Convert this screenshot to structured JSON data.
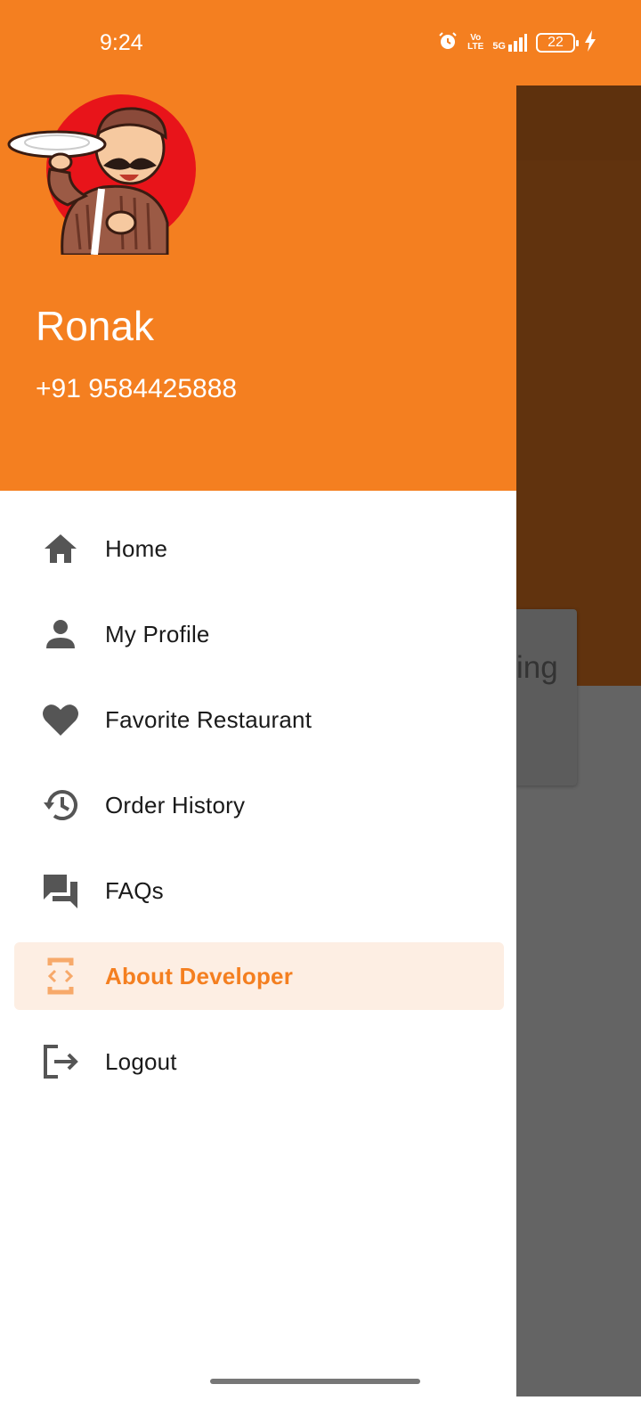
{
  "status_bar": {
    "time": "9:24",
    "icons": [
      "alarm-icon",
      "volte-icon",
      "5g-signal-icon",
      "battery-icon",
      "charging-icon"
    ],
    "network_top": "Vo",
    "network_bottom": "LTE",
    "network_type": "5G",
    "battery_level": "22"
  },
  "background_app": {
    "partial_text": "ing"
  },
  "drawer": {
    "header": {
      "user_name": "Ronak",
      "user_phone": "+91 9584425888",
      "avatar": "chef-avatar-image"
    },
    "items": [
      {
        "label": "Home",
        "icon": "home-icon",
        "selected": false
      },
      {
        "label": "My Profile",
        "icon": "person-icon",
        "selected": false
      },
      {
        "label": "Favorite Restaurant",
        "icon": "heart-icon",
        "selected": false
      },
      {
        "label": "Order History",
        "icon": "history-icon",
        "selected": false
      },
      {
        "label": "FAQs",
        "icon": "forum-icon",
        "selected": false
      },
      {
        "label": "About Developer",
        "icon": "developer-mode-icon",
        "selected": true
      },
      {
        "label": "Logout",
        "icon": "logout-icon",
        "selected": false
      }
    ]
  },
  "colors": {
    "primary": "#f47f20",
    "selected_background": "#fdeee3",
    "icon_gray": "#555555",
    "scrim": "#646464"
  }
}
